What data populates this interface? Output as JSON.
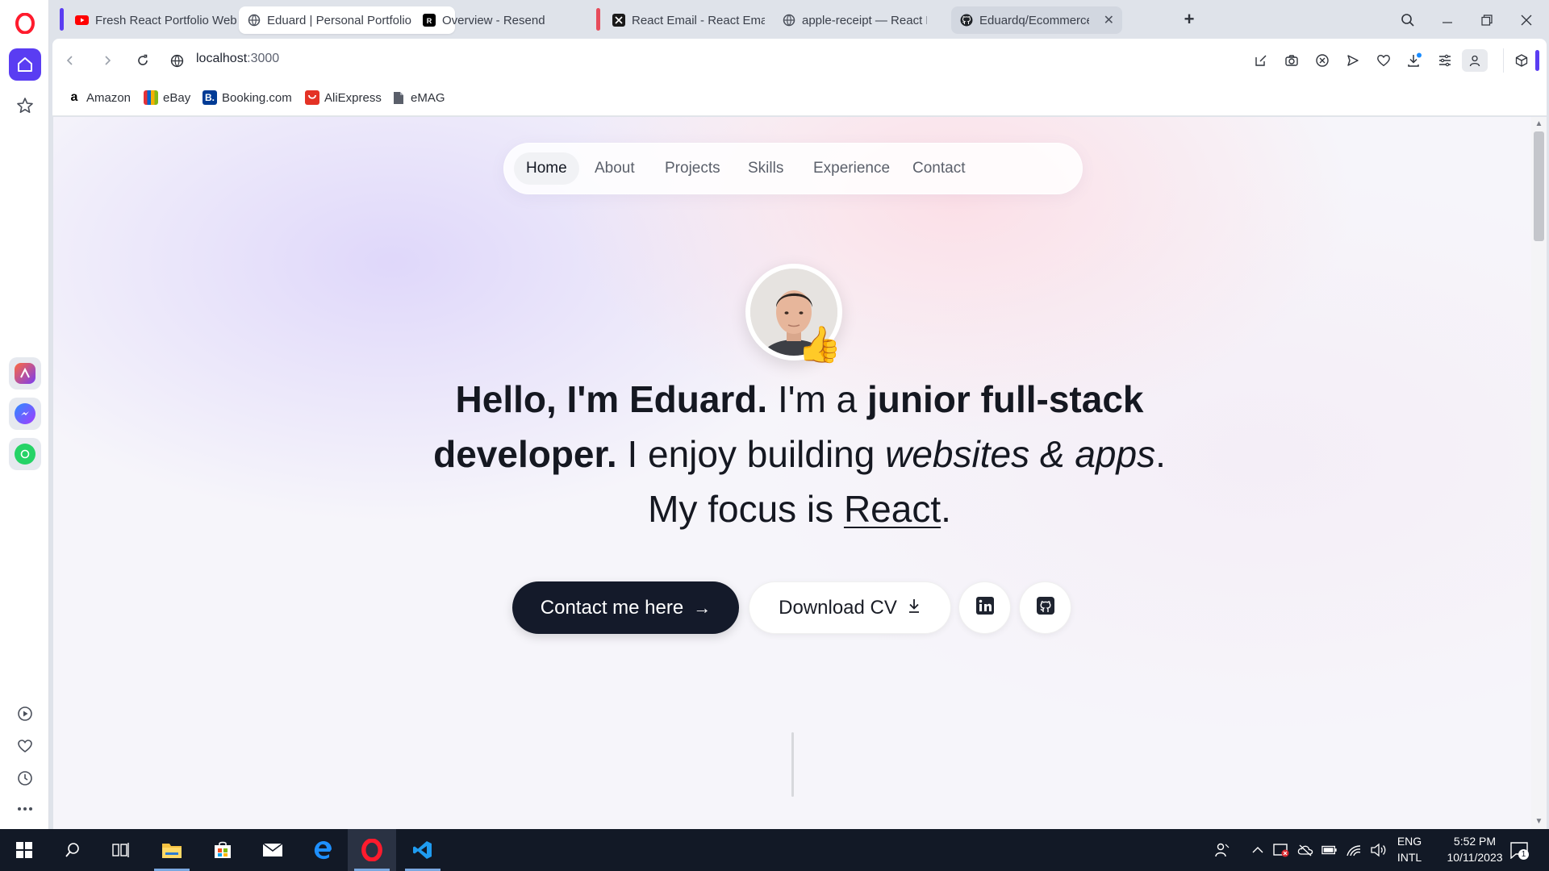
{
  "browser": {
    "tabs": [
      {
        "title": "Fresh React Portfolio Web",
        "favicon": "youtube-icon",
        "group_color": "#5a3df2"
      },
      {
        "title": "Eduard | Personal Portfolio",
        "favicon": "globe-icon",
        "active": true
      },
      {
        "title": "Overview - Resend",
        "favicon": "resend-icon"
      },
      {
        "title": "React Email - React Email",
        "favicon": "react-email-icon",
        "group_color": "#e74c5b"
      },
      {
        "title": "apple-receipt — React Em",
        "favicon": "globe-icon"
      },
      {
        "title": "Eduardq/Ecommerce",
        "favicon": "github-icon",
        "close": "✕"
      }
    ],
    "new_tab": "+",
    "address": {
      "host": "localhost",
      "port": ":3000"
    },
    "bookmarks": [
      {
        "label": "Amazon",
        "icon": "amazon-icon",
        "color": "#000000",
        "glyph": "a"
      },
      {
        "label": "eBay",
        "icon": "ebay-icon",
        "color": "#e53238",
        "glyph": ""
      },
      {
        "label": "Booking.com",
        "icon": "booking-icon",
        "color": "#003b95",
        "glyph": "B."
      },
      {
        "label": "AliExpress",
        "icon": "aliexpress-icon",
        "color": "#e43225",
        "glyph": ""
      },
      {
        "label": "eMAG",
        "icon": "document-icon",
        "color": "#5a5f6a",
        "glyph": ""
      }
    ],
    "brand_color": "#5a3df2"
  },
  "page": {
    "nav": [
      "Home",
      "About",
      "Projects",
      "Skills",
      "Experience",
      "Contact"
    ],
    "nav_active": "Home",
    "hero": {
      "greeting": "Hello, I'm Eduard.",
      "t1": " I'm a ",
      "role": "junior full-stack",
      "role2": "developer.",
      "t2": " I enjoy building ",
      "apps": "websites & apps",
      "dot": ".",
      "focus": "My focus is ",
      "tech": "React",
      "dot2": "."
    },
    "emoji": "👍",
    "cta_contact": "Contact me here",
    "cta_contact_arrow": "→",
    "cta_cv": "Download CV",
    "social": [
      "linkedin-icon",
      "github-icon"
    ]
  },
  "taskbar": {
    "apps": [
      "windows-start-icon",
      "search-icon",
      "task-view-icon",
      "file-explorer-icon",
      "microsoft-store-icon",
      "mail-icon",
      "edge-icon",
      "opera-icon",
      "vscode-icon"
    ],
    "lang1": "ENG",
    "lang2": "INTL",
    "time": "5:52 PM",
    "date": "10/11/2023",
    "notification_count": "1"
  }
}
